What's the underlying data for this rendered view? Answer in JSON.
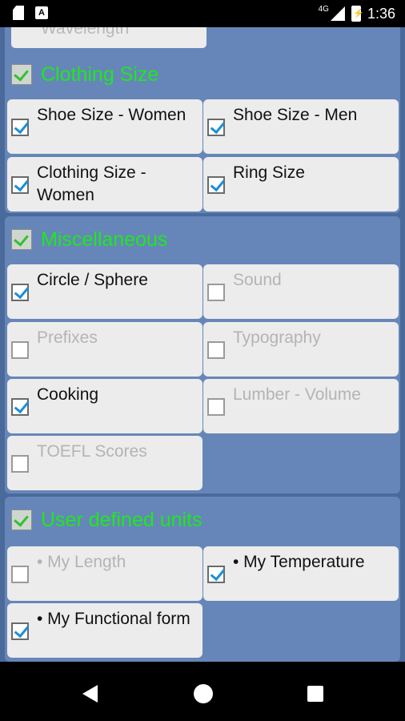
{
  "status_bar": {
    "time": "1:36",
    "network": "4G",
    "icons": [
      "sd-card-icon",
      "a-notification-icon",
      "signal-icon",
      "battery-charging-icon"
    ]
  },
  "partial_item": {
    "label": "Wavelength"
  },
  "sections": [
    {
      "title": "Clothing Size",
      "checked": true,
      "items": [
        {
          "label": "Shoe Size - Women",
          "checked": true
        },
        {
          "label": "Shoe Size - Men",
          "checked": true
        },
        {
          "label": "Clothing Size - Women",
          "checked": true
        },
        {
          "label": "Ring Size",
          "checked": true
        }
      ]
    },
    {
      "title": "Miscellaneous",
      "checked": true,
      "items": [
        {
          "label": "Circle / Sphere",
          "checked": true
        },
        {
          "label": "Sound",
          "checked": false
        },
        {
          "label": "Prefixes",
          "checked": false
        },
        {
          "label": "Typography",
          "checked": false
        },
        {
          "label": "Cooking",
          "checked": true
        },
        {
          "label": "Lumber - Volume",
          "checked": false
        },
        {
          "label": "TOEFL Scores",
          "checked": false
        }
      ]
    },
    {
      "title": "User defined units",
      "checked": true,
      "items": [
        {
          "label": "• My Length",
          "checked": false
        },
        {
          "label": "• My Temperature",
          "checked": true
        },
        {
          "label": "• My Functional form",
          "checked": true
        }
      ]
    }
  ],
  "nav_bar": {
    "icons": [
      "back-icon",
      "home-icon",
      "recents-icon"
    ]
  },
  "colors": {
    "panel": "#6686b9",
    "title": "#1ee81e",
    "check": "#1a8fd8"
  }
}
